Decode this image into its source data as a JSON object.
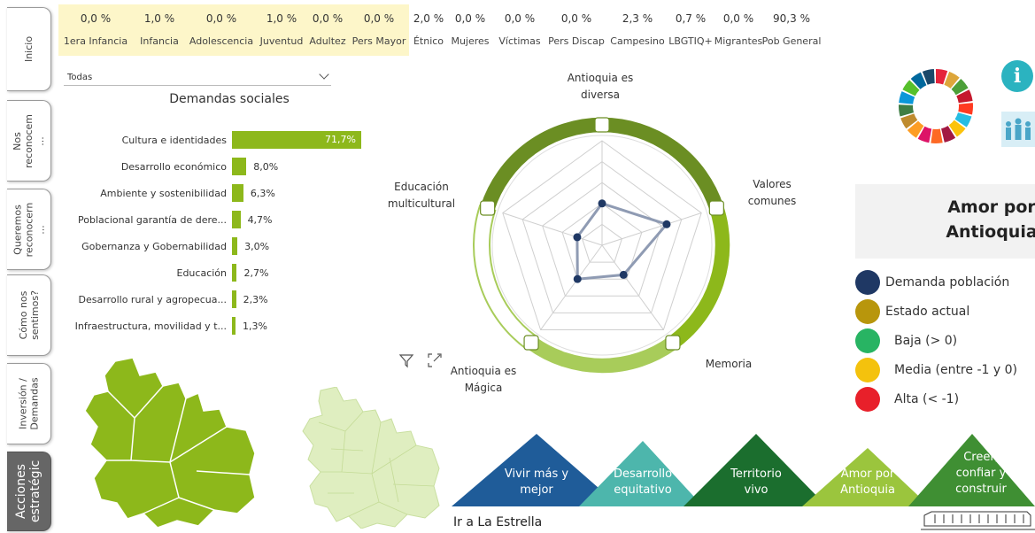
{
  "nav": {
    "tabs": [
      {
        "label": "Inicio",
        "active": false
      },
      {
        "label": "Nos\nreconocem\n...",
        "active": false
      },
      {
        "label": "Queremos\nreconocern\n...",
        "active": false
      },
      {
        "label": "Cómo nos\nsentimos?",
        "active": false
      },
      {
        "label": "Inversión /\nDemandas",
        "active": false
      },
      {
        "label": "Acciones\nestratégic",
        "active": true
      }
    ]
  },
  "stats": [
    {
      "value": "0,0 %",
      "label": "1era Infancia",
      "highlight": true
    },
    {
      "value": "1,0 %",
      "label": "Infancia",
      "highlight": true
    },
    {
      "value": "0,0 %",
      "label": "Adolescencia",
      "highlight": true
    },
    {
      "value": "1,0 %",
      "label": "Juventud",
      "highlight": true
    },
    {
      "value": "0,0 %",
      "label": "Adultez",
      "highlight": true
    },
    {
      "value": "0,0 %",
      "label": "Pers Mayor",
      "highlight": true
    },
    {
      "value": "2,0 %",
      "label": "Étnico",
      "highlight": false
    },
    {
      "value": "0,0 %",
      "label": "Mujeres",
      "highlight": false
    },
    {
      "value": "0,0 %",
      "label": "Víctimas",
      "highlight": false
    },
    {
      "value": "0,0 %",
      "label": "Pers Discap",
      "highlight": false
    },
    {
      "value": "2,3 %",
      "label": "Campesino",
      "highlight": false
    },
    {
      "value": "0,7 %",
      "label": "LBGTIQ+",
      "highlight": false
    },
    {
      "value": "0,0 %",
      "label": "Migrantes",
      "highlight": false
    },
    {
      "value": "90,3 %",
      "label": "Pob General",
      "highlight": false
    }
  ],
  "filter": {
    "selected": "Todas"
  },
  "demandas": {
    "title": "Demandas sociales",
    "bar_color": "#8db81b",
    "items": [
      {
        "label": "Cultura e identidades",
        "value": 71.7,
        "display": "71,7%"
      },
      {
        "label": "Desarrollo económico",
        "value": 8.0,
        "display": "8,0%"
      },
      {
        "label": "Ambiente y sostenibilidad",
        "value": 6.3,
        "display": "6,3%"
      },
      {
        "label": "Poblacional garantía de dere...",
        "value": 4.7,
        "display": "4,7%"
      },
      {
        "label": "Gobernanza y Gobernabilidad",
        "value": 3.0,
        "display": "3,0%"
      },
      {
        "label": "Educación",
        "value": 2.7,
        "display": "2,7%"
      },
      {
        "label": "Desarrollo rural y agropecua...",
        "value": 2.3,
        "display": "2,3%"
      },
      {
        "label": "Infraestructura, movilidad y t...",
        "value": 1.3,
        "display": "1,3%"
      }
    ]
  },
  "chart_data": {
    "type": "radar",
    "categories": [
      "Antioquia es diversa",
      "Valores comunes",
      "Memoria",
      "Antioquia es Mágica",
      "Educación multicultural"
    ],
    "series": [
      {
        "name": "Demanda población",
        "values": [
          0.4,
          0.65,
          0.35,
          0.4,
          0.25
        ]
      }
    ],
    "rlim": [
      0,
      1
    ],
    "ring_levels": 5
  },
  "radar_labels": {
    "top": "Antioquia es\ndiversa",
    "right": "Valores\ncomunes",
    "bottom_right": "Memoria",
    "bottom_left": "Antioquia es\nMágica",
    "left": "Educación\nmulticultural"
  },
  "legend": {
    "title": "Amor por\nAntioquia",
    "items": [
      {
        "label": "Demanda población",
        "color": "#1f3864"
      },
      {
        "label": "Estado actual",
        "color": "#b8960c"
      },
      {
        "label": "Baja (>  0)",
        "color": "#28b463"
      },
      {
        "label": "Media (entre -1 y 0)",
        "color": "#f4c20d"
      },
      {
        "label": "Alta (< -1)",
        "color": "#e8202a"
      }
    ]
  },
  "lineas": [
    {
      "label": "Vivir más y\nmejor",
      "color": "#1f5c99"
    },
    {
      "label": "Desarrollo\nequitativo",
      "color": "#4db6ac"
    },
    {
      "label": "Territorio\nvivo",
      "color": "#1b6e2e"
    },
    {
      "label": "Amor por\nAntioquia",
      "color": "#9bc53d"
    },
    {
      "label": "Creer,\nconfiar y\nconstruir",
      "color": "#3f8f33"
    }
  ],
  "link": {
    "label": "Ir a La Estrella"
  },
  "icons": {
    "filter": "filter-icon",
    "expand": "expand-icon",
    "info": "info-icon",
    "ods": "ods-wheel-icon",
    "people": "people-icon",
    "train": "train-icon"
  }
}
